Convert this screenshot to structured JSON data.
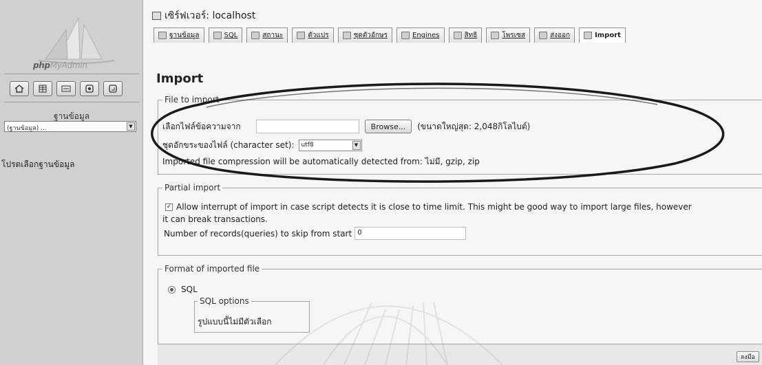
{
  "sidebar": {
    "logo_text_bold": "php",
    "logo_text_faded": "MyAdmin",
    "nav_icons": [
      "home-icon",
      "database-icon",
      "sql-query-icon",
      "docs-icon",
      "reload-icon"
    ],
    "database_label": "ฐานข้อมูล",
    "database_select_value": "(ฐานข้อมูล) ...",
    "choose_db_text": "โปรดเลือกฐานข้อมูล"
  },
  "header": {
    "server_label": "เซิร์ฟเวอร์: localhost"
  },
  "tabs": [
    {
      "label": "ฐานข้อมูล",
      "icon": "database-icon"
    },
    {
      "label": "SQL",
      "icon": "sql-icon"
    },
    {
      "label": "สถานะ",
      "icon": "status-icon"
    },
    {
      "label": "ตัวแปร",
      "icon": "variables-icon"
    },
    {
      "label": "ชุดตัวอักษร",
      "icon": "charset-icon"
    },
    {
      "label": "Engines",
      "icon": "engines-icon"
    },
    {
      "label": "สิทธิ",
      "icon": "privileges-icon"
    },
    {
      "label": "โพรเซส",
      "icon": "processes-icon"
    },
    {
      "label": "ส่งออก",
      "icon": "export-icon"
    },
    {
      "label": "Import",
      "icon": "import-icon",
      "active": true
    }
  ],
  "main": {
    "title": "Import",
    "file_section": {
      "legend": "File to import",
      "file_label": "เลือกไฟล์ข้อความจาก",
      "browse_label": "Browse...",
      "max_size_note": "(ขนาดใหญ่สุด: 2,048กิโลไบต์)",
      "charset_label": "ชุดอักขระของไฟล์ (character set):",
      "charset_value": "utf8",
      "compression_note": "Imported file compression will be automatically detected from: ไม่มี, gzip, zip"
    },
    "partial_section": {
      "legend": "Partial import",
      "allow_interrupt_checked": true,
      "allow_interrupt_text_line1": "Allow interrupt of import in case script detects it is close to time limit. This might be good way to import large files, however",
      "allow_interrupt_text_line2": "it can break transactions.",
      "skip_label": "Number of records(queries) to skip from start",
      "skip_value": "0"
    },
    "format_section": {
      "legend": "Format of imported file",
      "format_option": "SQL",
      "format_selected": true,
      "sql_options_legend": "SQL options",
      "sql_options_text": "รูปแบบนี้ไม่มีตัวเลือก"
    },
    "go_label": "ลงมือ"
  },
  "colors": {
    "sidebar_bg": "#d0d0ce",
    "main_bg": "#f6f6f4",
    "annotation_ink": "#1a1a1a"
  }
}
